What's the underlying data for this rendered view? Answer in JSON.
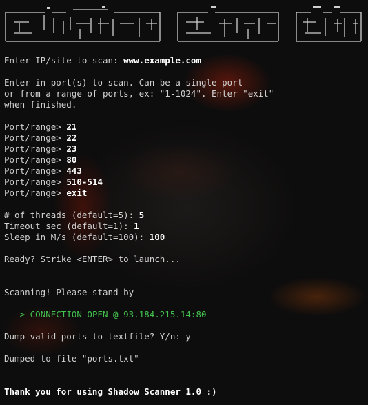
{
  "colors": {
    "background": "#141312",
    "text": "#d0d0d0",
    "bold_text": "#ffffff",
    "success": "#43c24f"
  },
  "banner_icon": "ascii-art-banner",
  "prompts": {
    "target_label": "Enter IP/site to scan: ",
    "target_value": "www.example.com",
    "ports_help_1": "Enter in port(s) to scan. Can be a single port",
    "ports_help_2": "or from a range of ports, ex: \"1-1024\". Enter \"exit\"",
    "ports_help_3": "when finished.",
    "port_prompt": "Port/range> "
  },
  "port_entries": [
    "21",
    "22",
    "23",
    "80",
    "443",
    "510-514",
    "exit"
  ],
  "settings": {
    "threads_label": "# of threads (default=5): ",
    "threads_value": "5",
    "timeout_label": "Timeout sec (default=1): ",
    "timeout_value": "1",
    "sleep_label": "Sleep in M/s (default=100): ",
    "sleep_value": "100"
  },
  "messages": {
    "ready": "Ready? Strike <ENTER> to launch...",
    "scanning": "Scanning! Please stand-by",
    "arrow": "———> ",
    "connection": "CONNECTION OPEN @ 93.184.215.14:80",
    "dump_question": "Dump valid ports to textfile? Y/n: y",
    "dumped": "Dumped to file \"ports.txt\"",
    "thanks": "Thank you for using Shadow Scanner 1.0 :)"
  }
}
